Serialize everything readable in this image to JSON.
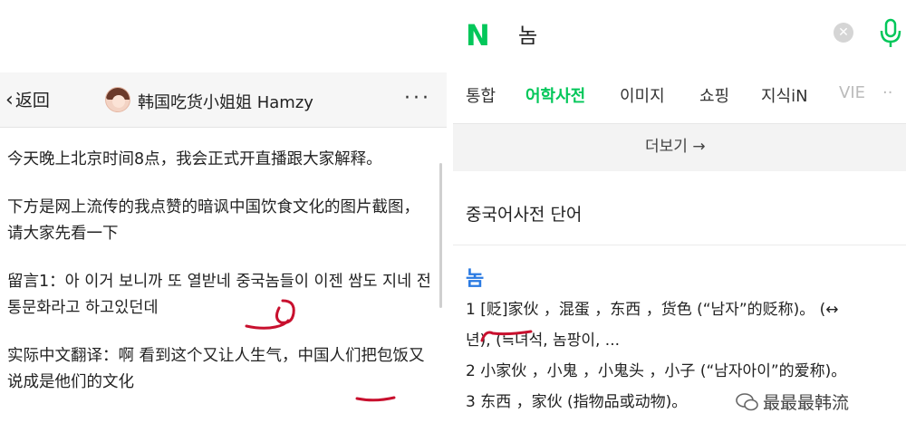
{
  "left": {
    "back_label": "返回",
    "title": "韩国吃货小姐姐 Hamzy",
    "more": "···",
    "paragraphs": [
      "今天晚上北京时间8点，我会正式开直播跟大家解释。",
      "下方是网上流传的我点赞的暗讽中国饮食文化的图片截图，请大家先看一下",
      "留言1：아 이거 보니까 또 열받네 중국놈들이 이젠 쌈도 지네 전통문화라고 하고있던데",
      "实际中文翻译：啊 看到这个又让人生气，中国人们把包饭又说成是他们的文化"
    ]
  },
  "right": {
    "logo": "N",
    "query": "놈",
    "tabs": [
      "통합",
      "어학사전",
      "이미지",
      "쇼핑",
      "지식iN",
      "VIE",
      "··"
    ],
    "more_button": "더보기 →",
    "section_title": "중국어사전 단어",
    "word": "놈",
    "definitions": [
      "1 [贬]家伙 ，混蛋 ，东西 ，货色 (“남자”的贬称)。 (↔",
      "   년), (≒녀석, 놈팡이, ...",
      "2 小家伙 ，小鬼 ，小鬼头 ，小子 (“남자아이”的爱称)。",
      "3 东西 ，家伙 (指物品或动物)。"
    ]
  },
  "watermark": "最最最韩流",
  "colors": {
    "naver_green": "#03c75a",
    "word_blue": "#2a7ae2",
    "annotation_red": "#c8102e"
  }
}
